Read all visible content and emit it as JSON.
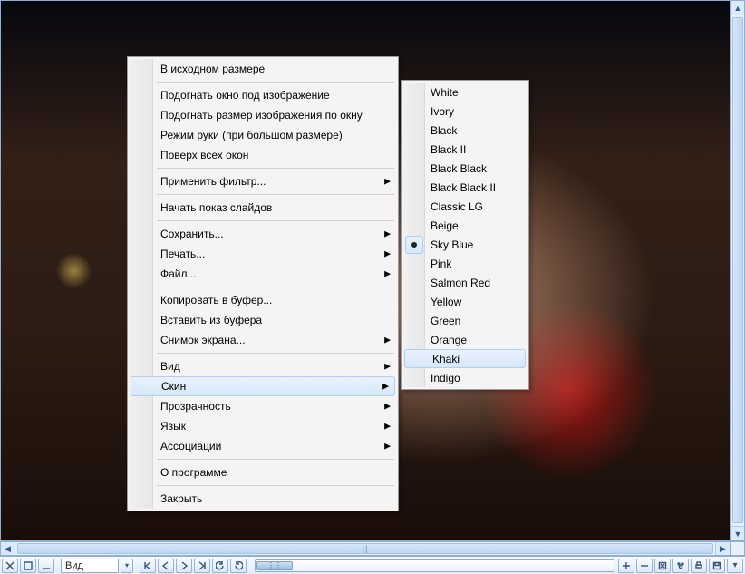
{
  "context_menu": {
    "items": [
      {
        "label": "В исходном размере",
        "submenu": false
      },
      {
        "sep": true
      },
      {
        "label": "Подогнать окно под изображение",
        "submenu": false
      },
      {
        "label": "Подогнать размер изображения по окну",
        "submenu": false
      },
      {
        "label": "Режим руки (при большом размере)",
        "submenu": false
      },
      {
        "label": "Поверх всех окон",
        "submenu": false
      },
      {
        "sep": true
      },
      {
        "label": "Применить фильтр...",
        "submenu": true
      },
      {
        "sep": true
      },
      {
        "label": "Начать показ слайдов",
        "submenu": false
      },
      {
        "sep": true
      },
      {
        "label": "Сохранить...",
        "submenu": true
      },
      {
        "label": "Печать...",
        "submenu": true
      },
      {
        "label": "Файл...",
        "submenu": true
      },
      {
        "sep": true
      },
      {
        "label": "Копировать в буфер...",
        "submenu": false
      },
      {
        "label": "Вставить из буфера",
        "submenu": false
      },
      {
        "label": "Снимок экрана...",
        "submenu": true
      },
      {
        "sep": true
      },
      {
        "label": "Вид",
        "submenu": true
      },
      {
        "label": "Скин",
        "submenu": true,
        "highlight": true
      },
      {
        "label": "Прозрачность",
        "submenu": true
      },
      {
        "label": "Язык",
        "submenu": true
      },
      {
        "label": "Ассоциации",
        "submenu": true
      },
      {
        "sep": true
      },
      {
        "label": "О программе",
        "submenu": false
      },
      {
        "sep": true
      },
      {
        "label": "Закрыть",
        "submenu": false
      }
    ]
  },
  "skin_submenu": {
    "selected": "Sky Blue",
    "hover": "Khaki",
    "items": [
      "White",
      "Ivory",
      "Black",
      "Black II",
      "Black Black",
      "Black Black II",
      "Classic LG",
      "Beige",
      "Sky Blue",
      "Pink",
      "Salmon Red",
      "Yellow",
      "Green",
      "Orange",
      "Khaki",
      "Indigo"
    ]
  },
  "toolbar": {
    "view_label": "Вид"
  },
  "scroll": {
    "h_grip": "||"
  }
}
